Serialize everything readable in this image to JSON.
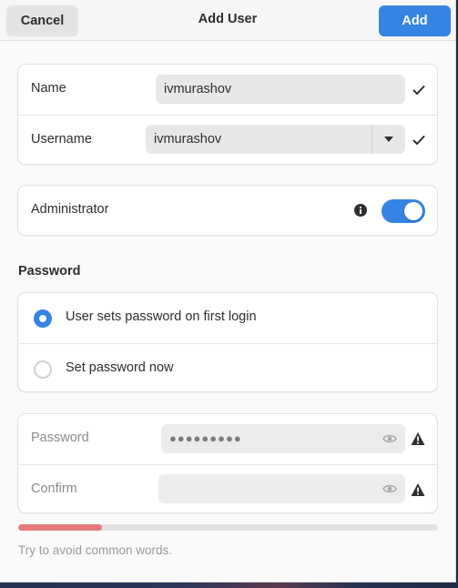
{
  "header": {
    "title": "Add User",
    "cancel_label": "Cancel",
    "add_label": "Add"
  },
  "account": {
    "name_label": "Name",
    "name_value": "ivmurashov",
    "username_label": "Username",
    "username_value": "ivmurashov"
  },
  "admin": {
    "label": "Administrator",
    "enabled": true
  },
  "password_section": {
    "title": "Password",
    "options": [
      {
        "label": "User sets password on first login",
        "selected": true
      },
      {
        "label": "Set password now",
        "selected": false
      }
    ],
    "password_label": "Password",
    "password_masked": "●●●●●●●●●",
    "confirm_label": "Confirm",
    "confirm_value": "",
    "strength_fraction": 0.2,
    "hint": "Try to avoid common words."
  },
  "colors": {
    "accent": "#3584e4",
    "strength_weak": "#e67a7a"
  },
  "icons": [
    "check-icon",
    "dropdown-arrow-icon",
    "info-icon",
    "eye-icon",
    "warning-icon"
  ]
}
